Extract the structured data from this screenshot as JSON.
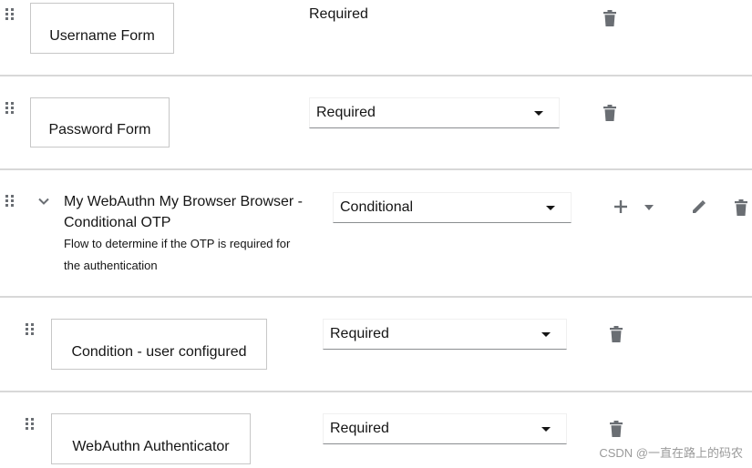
{
  "rows": [
    {
      "name": "Username Form",
      "requirement": "Required"
    },
    {
      "name": "Password Form",
      "requirement": "Required"
    },
    {
      "name": "My WebAuthn My Browser Browser - Conditional OTP",
      "description": "Flow to determine if the OTP is required for the authentication",
      "requirement": "Conditional"
    },
    {
      "name": "Condition - user configured",
      "requirement": "Required"
    },
    {
      "name": "WebAuthn Authenticator",
      "requirement": "Required"
    }
  ],
  "icons": {
    "drag": "drag-handle-icon",
    "delete": "trash-icon",
    "expand": "chevron-down-icon",
    "add": "plus-icon",
    "add_menu": "caret-down-icon",
    "edit": "pencil-icon"
  },
  "watermark": "CSDN @一直在路上的码农",
  "colors": {
    "icon": "#6a6e73",
    "divider": "#d8d8d8",
    "text": "#151515"
  }
}
